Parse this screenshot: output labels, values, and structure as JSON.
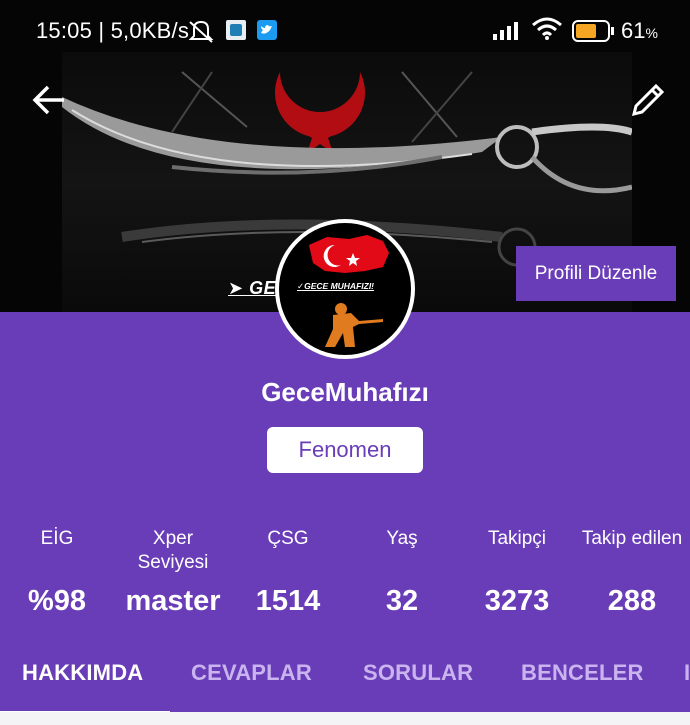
{
  "status_bar": {
    "time": "15:05",
    "speed": "| 5,0KB/s",
    "twitter_icon": "twitter-icon",
    "battery_percent": "61",
    "battery_unit": "%"
  },
  "cover": {
    "banner_text_left": "➤ GEC",
    "banner_text_right": "!"
  },
  "header": {
    "edit_profile_label": "Profili Düzenle"
  },
  "avatar": {
    "caption": "✓GECE MUHAFIZI!"
  },
  "profile": {
    "username": "GeceMuhafızı",
    "rank": "Fenomen"
  },
  "stats": [
    {
      "label": "EİG",
      "value": "%98"
    },
    {
      "label": "Xper Seviyesi",
      "value": "master"
    },
    {
      "label": "ÇSG",
      "value": "1514"
    },
    {
      "label": "Yaş",
      "value": "32"
    },
    {
      "label": "Takipçi",
      "value": "3273"
    },
    {
      "label": "Takip edilen",
      "value": "288"
    }
  ],
  "tabs": [
    {
      "label": "HAKKIMDA"
    },
    {
      "label": "CEVAPLAR"
    },
    {
      "label": "SORULAR"
    },
    {
      "label": "BENCELER"
    }
  ],
  "colors": {
    "accent": "#6a3db8",
    "tab_inactive": "#c9b4ef",
    "flag_red": "#e30a17"
  }
}
